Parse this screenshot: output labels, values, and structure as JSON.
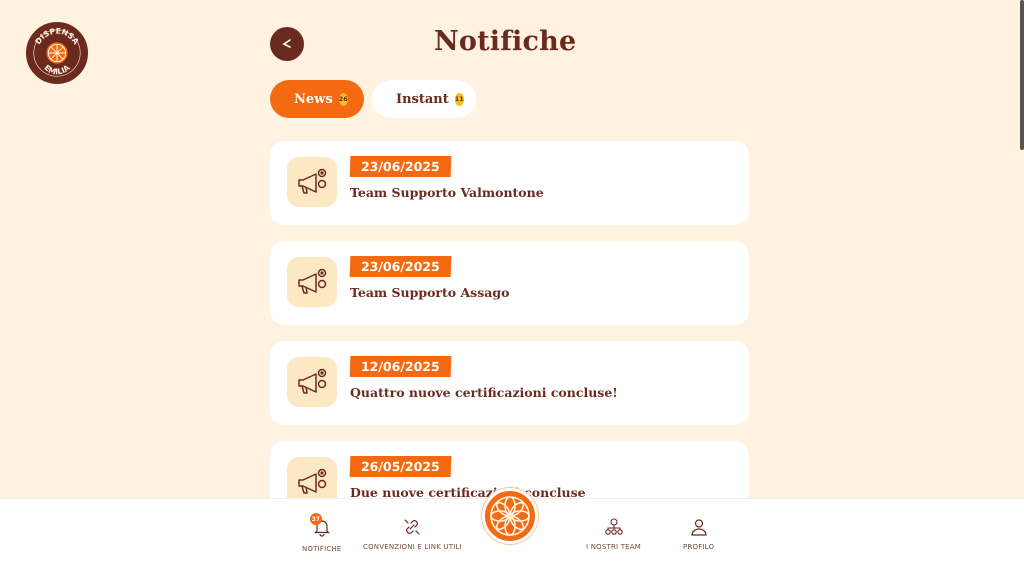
{
  "logo": {
    "top": "DISPENSA",
    "bottom": "EMILIA"
  },
  "header": {
    "title": "Notifiche"
  },
  "tabs": [
    {
      "label": "News",
      "count": "26",
      "active": true
    },
    {
      "label": "Instant",
      "count": "11",
      "active": false
    }
  ],
  "notifications": [
    {
      "date": "23/06/2025",
      "title": "Team Supporto Valmontone"
    },
    {
      "date": "23/06/2025",
      "title": "Team Supporto Assago"
    },
    {
      "date": "12/06/2025",
      "title": "Quattro nuove certificazioni concluse!"
    },
    {
      "date": "26/05/2025",
      "title": "Due nuove certificazioni concluse"
    }
  ],
  "bottom_nav": {
    "notifiche": {
      "label": "NOTIFICHE",
      "badge": "37"
    },
    "convenzioni": {
      "label": "CONVENZIONI E LINK UTILI"
    },
    "team": {
      "label": "I NOSTRI TEAM"
    },
    "profilo": {
      "label": "PROFILO"
    }
  },
  "colors": {
    "accent": "#f46a12",
    "brand": "#6b2a1e",
    "background": "#fff2e0",
    "badge": "#f5c018"
  },
  "icons": [
    "back-arrow-icon",
    "megaphone-icon",
    "bell-icon",
    "link-icon",
    "team-icon",
    "profile-icon",
    "orange-slice-icon"
  ]
}
